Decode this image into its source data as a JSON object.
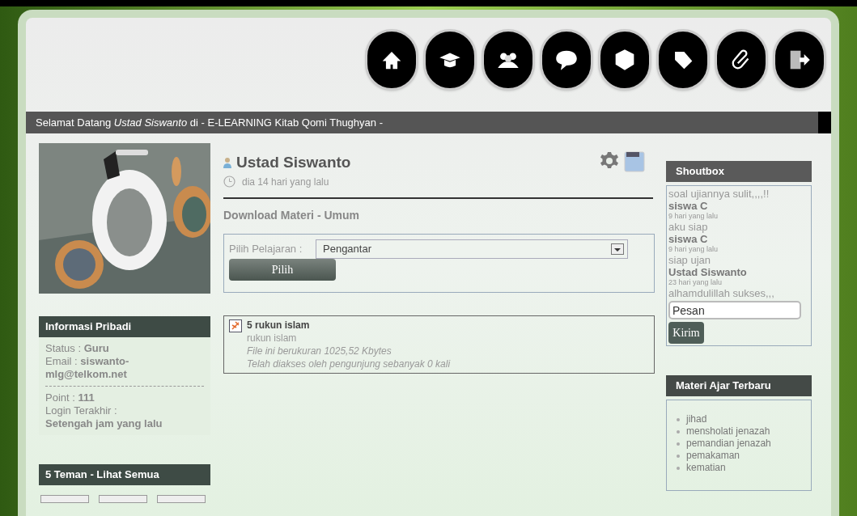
{
  "nav": [
    {
      "kind": "home"
    },
    {
      "kind": "hat"
    },
    {
      "kind": "people"
    },
    {
      "kind": "chat"
    },
    {
      "kind": "box"
    },
    {
      "kind": "tag"
    },
    {
      "kind": "clip"
    },
    {
      "kind": "exit"
    }
  ],
  "welcome": "Selamat Datang *Ustad Siswanto* di - E-LEARNING Kitab Qomi Thughyan -",
  "info": {
    "title": "Informasi Pribadi",
    "lines": [
      "Status : **Guru**",
      "Email : **siswanto-mlg@telkom.net**"
    ],
    "lines2": [
      "Point : **111**",
      "Login Terakhir :",
      "**Setengah jam yang lalu**"
    ]
  },
  "friends": {
    "title": "5 Teman - Lihat Semua"
  },
  "user": {
    "name": "Ustad Siswanto",
    "time": "dia 14 hari yang lalu"
  },
  "section_title": "Download Materi - Umum",
  "form": {
    "label": "Pilih Pelajaran :",
    "value": "Pengantar",
    "button": "Pilih"
  },
  "file": {
    "title": "5 rukun islam",
    "desc": "rukun islam",
    "size": "File ini berukuran 1025,52 Kbytes",
    "views": "Telah diakses oleh pengunjung sebanyak 0 kali"
  },
  "shoutbox": {
    "title": "Shoutbox",
    "lines": [
      {
        "kind": "message",
        "text": "soal ujiannya sulit,,,,!!"
      },
      {
        "kind": "author",
        "text": "siswa C"
      },
      {
        "kind": "time",
        "text": "9 hari yang lalu"
      },
      {
        "kind": "message",
        "text": "aku siap"
      },
      {
        "kind": "author",
        "text": "siswa C"
      },
      {
        "kind": "time",
        "text": "9 hari yang lalu"
      },
      {
        "kind": "message",
        "text": "siap ujan"
      },
      {
        "kind": "author",
        "text": "Ustad Siswanto"
      },
      {
        "kind": "time",
        "text": "23 hari yang lalu"
      },
      {
        "kind": "message",
        "text": "alhamdulillah sukses,,,"
      }
    ],
    "placeholder": "Pesan",
    "button": "Kirim"
  },
  "materi": {
    "title": "Materi Ajar Terbaru",
    "items": [
      "jihad",
      "mensholati jenazah",
      "pemandian jenazah",
      "pemakaman",
      "kematian"
    ]
  }
}
